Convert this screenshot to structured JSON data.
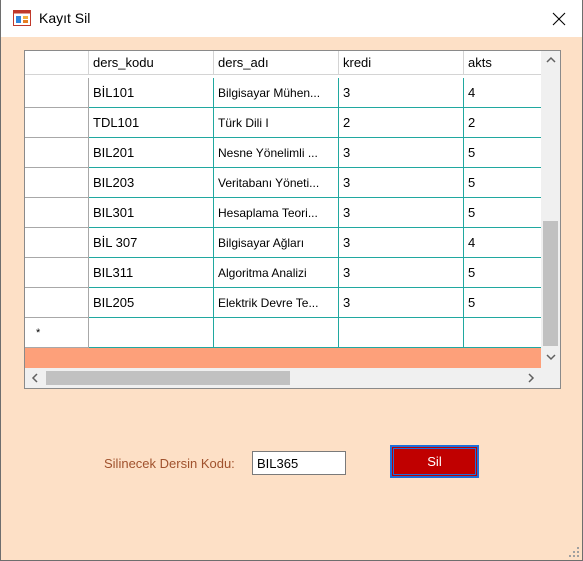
{
  "window": {
    "title": "Kayıt Sil",
    "icons": {
      "app": "form-app-icon",
      "close": "close-icon"
    }
  },
  "grid": {
    "columns": [
      "ders_kodu",
      "ders_adı",
      "kredi",
      "akts"
    ],
    "rows": [
      [
        "BİL101",
        "Bilgisayar Mühen...",
        "3",
        "4"
      ],
      [
        "TDL101",
        "Türk Dili I",
        "2",
        "2"
      ],
      [
        "BIL201",
        "Nesne Yönelimli ...",
        "3",
        "5"
      ],
      [
        "BIL203",
        "Veritabanı Yöneti...",
        "3",
        "5"
      ],
      [
        "BIL301",
        "Hesaplama Teori...",
        "3",
        "5"
      ],
      [
        "BİL 307",
        "Bilgisayar Ağları",
        "3",
        "4"
      ],
      [
        "BIL311",
        "Algoritma Analizi",
        "3",
        "5"
      ],
      [
        "BIL205",
        "Elektrik Devre Te...",
        "3",
        "5"
      ]
    ],
    "new_row_marker": "*",
    "colors": {
      "grid_line": "#20a8a0",
      "strip": "#fda07a"
    }
  },
  "form": {
    "label": "Silinecek Dersin Kodu:",
    "code_value": "BIL365",
    "delete_button": "Sil",
    "colors": {
      "background": "#fde0c6",
      "label": "#a0522d",
      "button": "#c00000"
    }
  }
}
